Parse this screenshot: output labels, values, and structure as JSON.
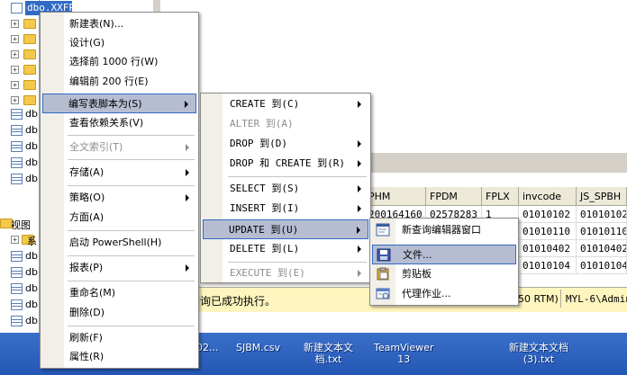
{
  "tree": {
    "selected_item": "dbo.XXFP",
    "db_labels": [
      "db",
      "db",
      "db",
      "db",
      "db"
    ],
    "views_label": "视图",
    "sys_label": "系",
    "sub_db_labels": [
      "db",
      "db",
      "db",
      "db",
      "db"
    ]
  },
  "grid": {
    "columns": [
      "PHM",
      "FPDM",
      "FPLX",
      "invcode",
      "JS_SPBH"
    ],
    "rows": [
      [
        "200164160",
        "02578283",
        "1",
        "01010102",
        "01010102"
      ],
      [
        "",
        "",
        "",
        "01010110",
        "01010110"
      ],
      [
        "",
        "",
        "",
        "01010402",
        "01010402"
      ],
      [
        "",
        "",
        "",
        "01010104",
        "01010104"
      ]
    ]
  },
  "status": {
    "message": "查询已成功执行。",
    "version_fragment": "50 RTM)",
    "user": "MYL-6\\Admini"
  },
  "context_menu": {
    "items": [
      {
        "label": "新建表(N)...",
        "submenu": false,
        "disabled": false
      },
      {
        "label": "设计(G)",
        "submenu": false,
        "disabled": false
      },
      {
        "label": "选择前 1000 行(W)",
        "submenu": false,
        "disabled": false
      },
      {
        "label": "编辑前 200 行(E)",
        "submenu": false,
        "disabled": false
      },
      {
        "label": "编写表脚本为(S)",
        "submenu": true,
        "disabled": false,
        "highlighted": true
      },
      {
        "label": "查看依赖关系(V)",
        "submenu": false,
        "disabled": false
      },
      {
        "label": "全文索引(T)",
        "submenu": true,
        "disabled": true
      },
      {
        "label": "存储(A)",
        "submenu": true,
        "disabled": false
      },
      {
        "label": "策略(O)",
        "submenu": true,
        "disabled": false
      },
      {
        "label": "方面(A)",
        "submenu": false,
        "disabled": false
      },
      {
        "label": "启动 PowerShell(H)",
        "submenu": false,
        "disabled": false
      },
      {
        "label": "报表(P)",
        "submenu": true,
        "disabled": false
      },
      {
        "label": "重命名(M)",
        "submenu": false,
        "disabled": false
      },
      {
        "label": "删除(D)",
        "submenu": false,
        "disabled": false
      },
      {
        "label": "刷新(F)",
        "submenu": false,
        "disabled": false
      },
      {
        "label": "属性(R)",
        "submenu": false,
        "disabled": false
      }
    ]
  },
  "script_submenu": {
    "items": [
      {
        "label": "CREATE 到(C)",
        "disabled": false
      },
      {
        "label": "ALTER 到(A)",
        "disabled": true
      },
      {
        "label": "DROP 到(D)",
        "disabled": false
      },
      {
        "label": "DROP 和 CREATE 到(R)",
        "disabled": false
      },
      {
        "label": "SELECT 到(S)",
        "disabled": false
      },
      {
        "label": "INSERT 到(I)",
        "disabled": false
      },
      {
        "label": "UPDATE 到(U)",
        "disabled": false,
        "highlighted": true
      },
      {
        "label": "DELETE 到(L)",
        "disabled": false
      },
      {
        "label": "EXECUTE 到(E)",
        "disabled": true
      }
    ]
  },
  "target_submenu": {
    "items": [
      {
        "label": "新查询编辑器窗口",
        "icon": "query-window-icon"
      },
      {
        "label": "文件...",
        "icon": "save-file-icon",
        "highlighted": true
      },
      {
        "label": "剪贴板",
        "icon": "clipboard-icon"
      },
      {
        "label": "代理作业...",
        "icon": "agent-job-icon"
      }
    ]
  },
  "desktop": {
    "items": [
      {
        "line1": "02...",
        "line2": ""
      },
      {
        "line1": "SJBM.csv",
        "line2": ""
      },
      {
        "line1": "新建文本文",
        "line2": "档.txt"
      },
      {
        "line1": "TeamViewer",
        "line2": "13"
      },
      {
        "line1": "新建文本文档",
        "line2": "(3).txt"
      }
    ]
  },
  "colors": {
    "selection": "#316ac5",
    "menu_highlight": "#b6bdd2",
    "status_bar": "#fff6bf",
    "taskbar": "#2f64c0"
  }
}
